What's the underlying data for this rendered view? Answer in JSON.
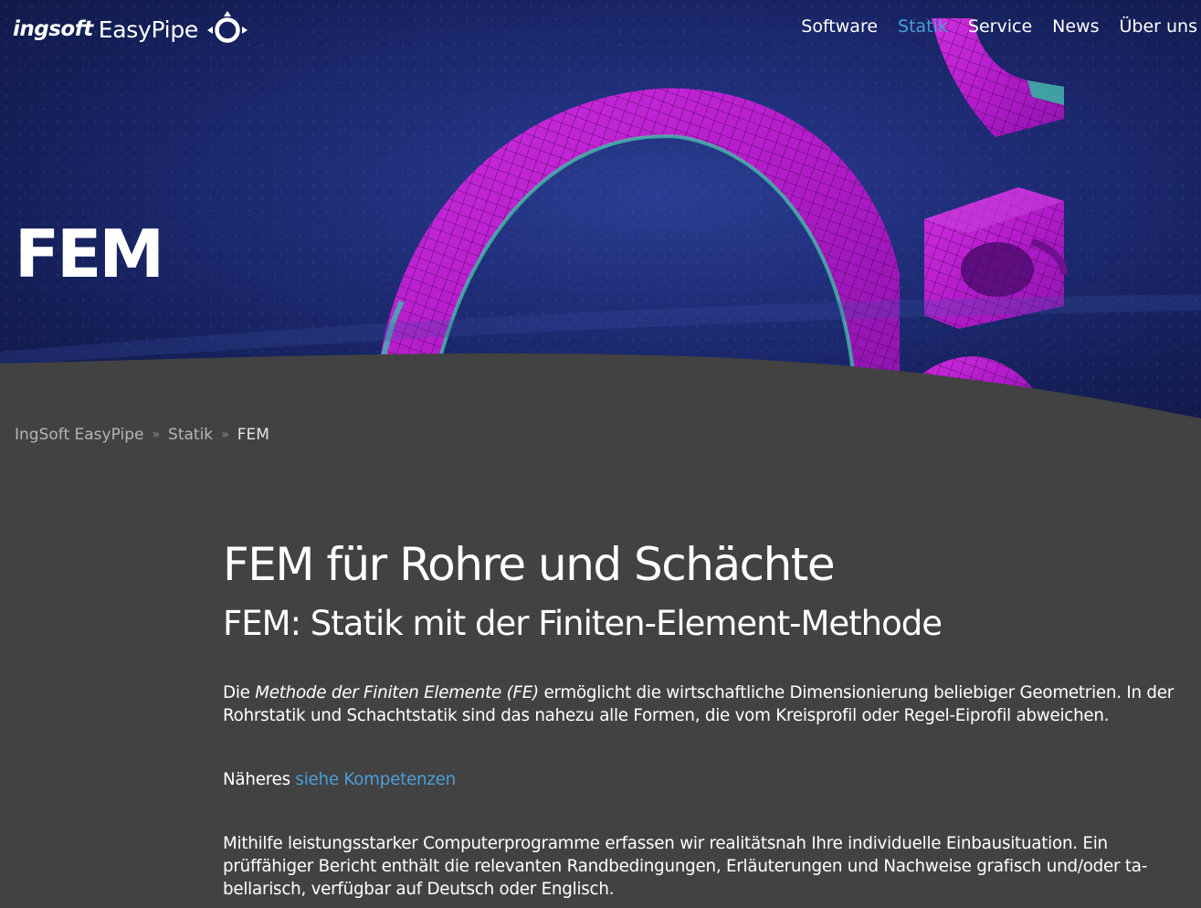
{
  "header": {
    "logo_part1": "ingsoft",
    "logo_part2": "EasyPipe",
    "nav": [
      {
        "label": "Software",
        "active": false
      },
      {
        "label": "Statik",
        "active": true
      },
      {
        "label": "Service",
        "active": false
      },
      {
        "label": "News",
        "active": false
      },
      {
        "label": "Über uns",
        "active": false
      }
    ]
  },
  "hero": {
    "title": "FEM"
  },
  "breadcrumb": {
    "items": [
      "IngSoft EasyPipe",
      "Statik"
    ],
    "separator": "»",
    "current": "FEM"
  },
  "main": {
    "heading": "FEM für Rohre und Schächte",
    "subheading": "FEM: Statik mit der Finiten-Element-Methode",
    "p1_prefix": "Die",
    "p1_emphasis": "Methode der Finiten Elemente (FE)",
    "p1_rest": "ermöglicht die wirtschaftliche Dimensionierung beliebiger Geometrien. In der Rohrstatik und Schachtstatik sind das nahezu alle Formen, die vom Kreisprofil oder Regel-Eiprofil abweichen.",
    "p2_prefix": "Näheres",
    "p2_link": "siehe Kompetenzen",
    "p3_line1": "Mithilfe leistungsstarker Computerprogramme erfassen wir realitätsnah Ihre individuelle Einbausituation. Ein",
    "p3_line2": "prüffähiger Bericht enthält die relevanten Randbedingungen, Erläuterungen und Nachweise grafisch und/oder ta-",
    "p3_line3": "bellarisch, verfügbar auf Deutsch oder Englisch."
  },
  "colors": {
    "background": "#424242",
    "accent": "#4a9fd8",
    "hero_blue": "#1f2d78",
    "mesh_magenta": "#c21fd6"
  },
  "icons": {
    "logo_mark": "ring-with-arrows-icon"
  }
}
